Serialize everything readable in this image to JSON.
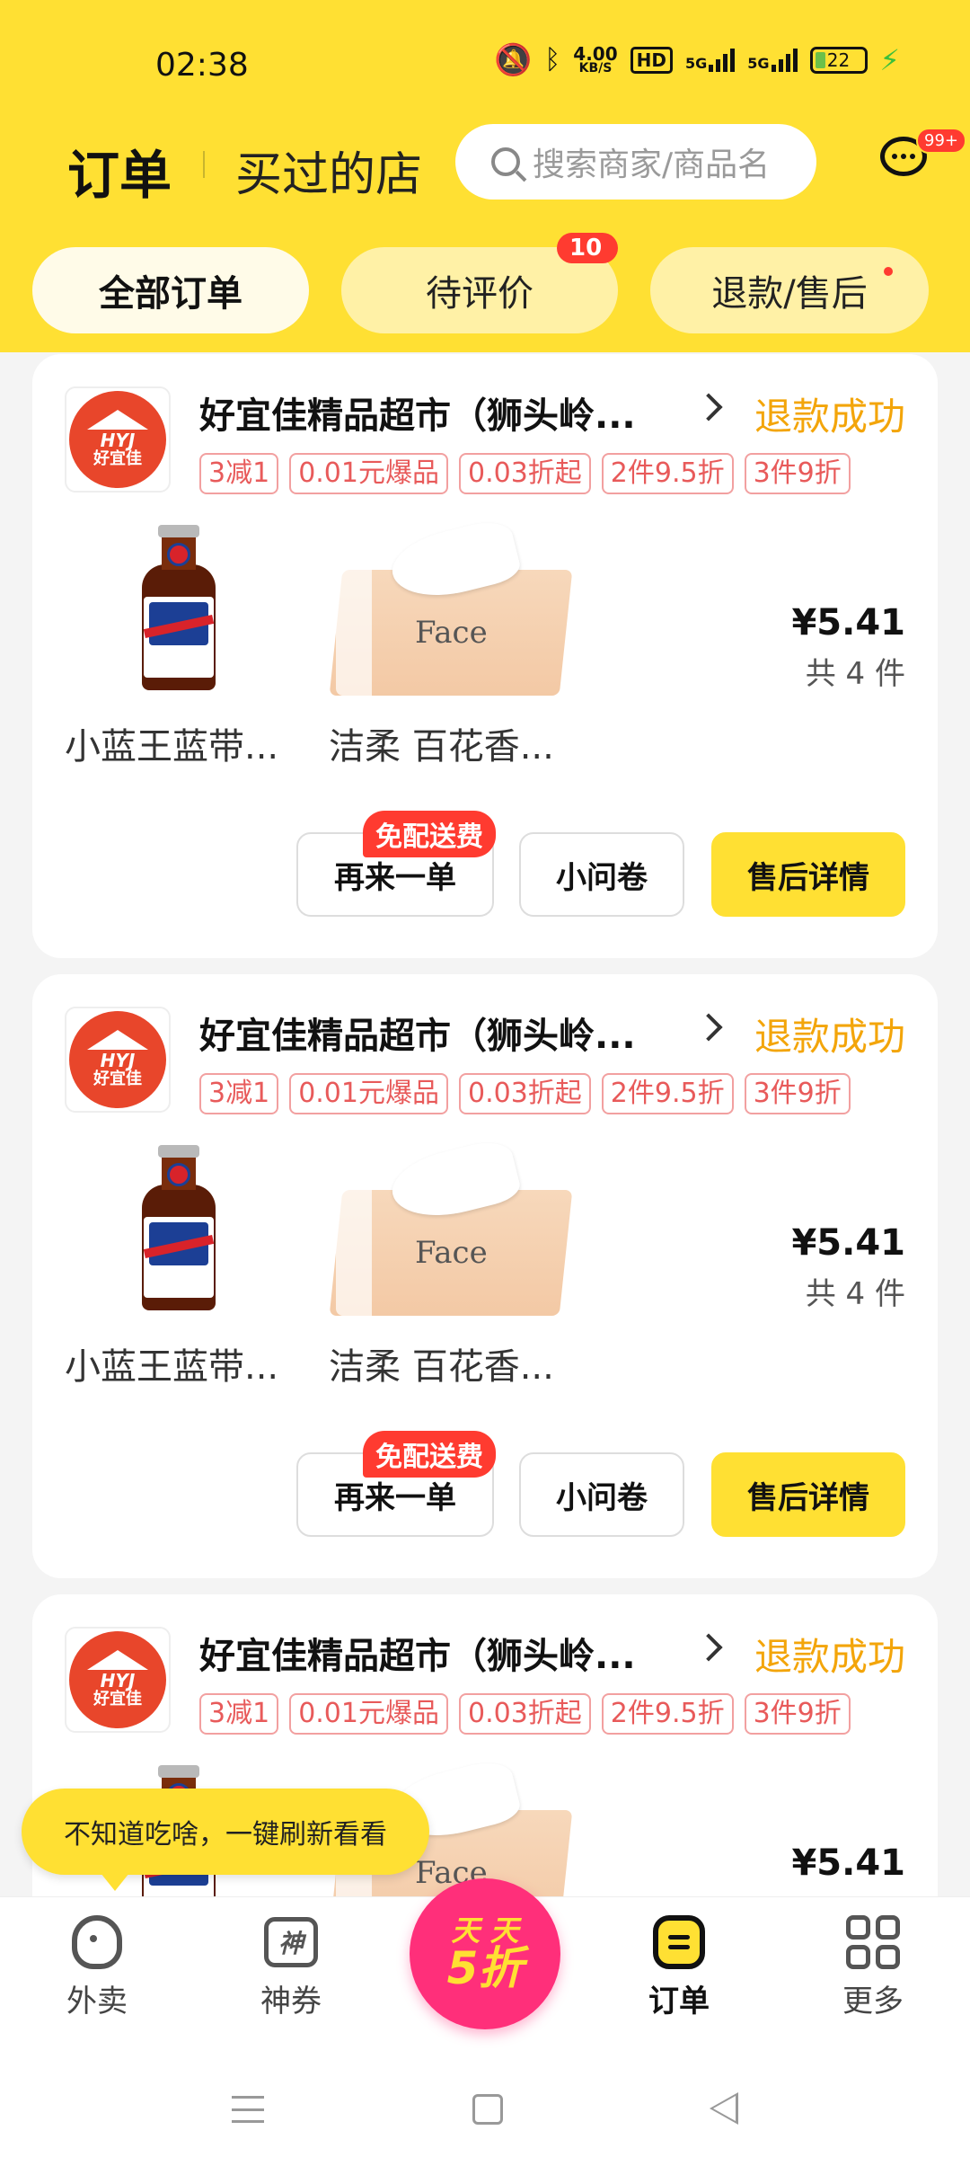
{
  "statusbar": {
    "time": "02:38",
    "netspeed_value": "4.00",
    "netspeed_unit": "KB/S",
    "hd": "HD",
    "sig1": "5G",
    "sig2": "5G",
    "battery": "22"
  },
  "header": {
    "title": "订单",
    "subtitle": "买过的店",
    "search_placeholder": "搜索商家/商品名",
    "msg_badge": "99+"
  },
  "tabs": [
    {
      "label": "全部订单"
    },
    {
      "label": "待评价",
      "badge": "10"
    },
    {
      "label": "退款/售后"
    }
  ],
  "orders": [
    {
      "store": "好宜佳精品超市（狮头岭...",
      "status": "退款成功",
      "logo_abbr": "HYJ",
      "logo_cn": "好宜佳",
      "promos": [
        "3减1",
        "0.01元爆品",
        "0.03折起",
        "2件9.5折",
        "3件9折"
      ],
      "products": [
        {
          "name": "小蓝王蓝带..."
        },
        {
          "name": "洁柔 百花香..."
        }
      ],
      "product2_brand": "Face",
      "price": "¥5.41",
      "count": "共 4 件",
      "ribbon": "免配送费",
      "buttons": {
        "reorder": "再来一单",
        "survey": "小问卷",
        "aftersale": "售后详情"
      }
    },
    {
      "store": "好宜佳精品超市（狮头岭...",
      "status": "退款成功",
      "logo_abbr": "HYJ",
      "logo_cn": "好宜佳",
      "promos": [
        "3减1",
        "0.01元爆品",
        "0.03折起",
        "2件9.5折",
        "3件9折"
      ],
      "products": [
        {
          "name": "小蓝王蓝带..."
        },
        {
          "name": "洁柔 百花香..."
        }
      ],
      "product2_brand": "Face",
      "price": "¥5.41",
      "count": "共 4 件",
      "ribbon": "免配送费",
      "buttons": {
        "reorder": "再来一单",
        "survey": "小问卷",
        "aftersale": "售后详情"
      }
    },
    {
      "store": "好宜佳精品超市（狮头岭...",
      "status": "退款成功",
      "logo_abbr": "HYJ",
      "logo_cn": "好宜佳",
      "promos": [
        "3减1",
        "0.01元爆品",
        "0.03折起",
        "2件9.5折",
        "3件9折"
      ],
      "product2_brand": "Face",
      "price": "¥5.41"
    }
  ],
  "tooltip": "不知道吃啥，一键刷新看看",
  "bottomnav": {
    "waimai": "外卖",
    "shenquan": "神券",
    "shen_icon_char": "神",
    "center_l1": "天 天",
    "center_l2": "5折",
    "orders": "订单",
    "more": "更多"
  }
}
